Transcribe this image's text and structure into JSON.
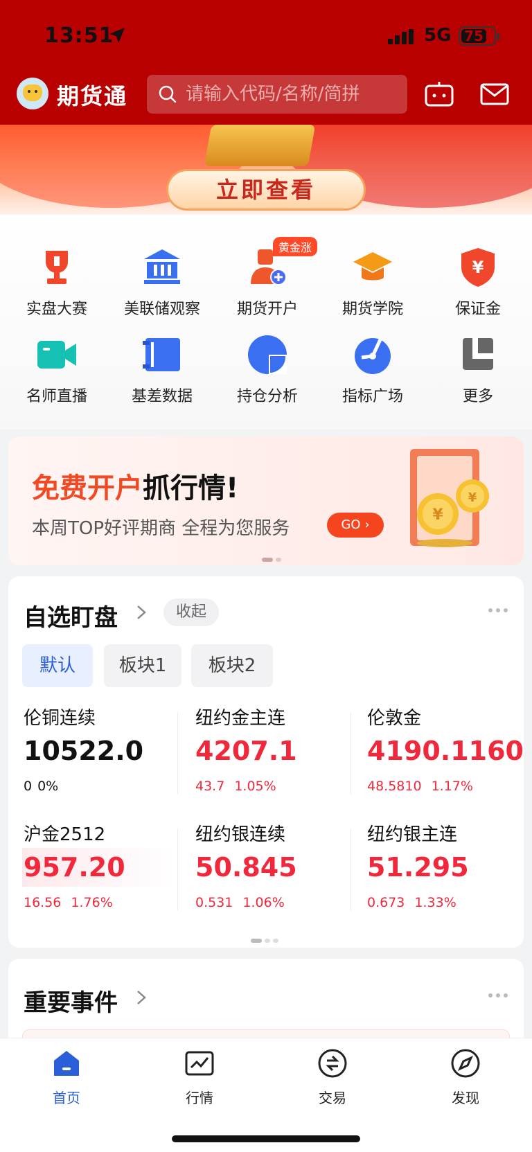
{
  "status": {
    "time": "13:51",
    "network": "5G",
    "battery": "75"
  },
  "header": {
    "app_name": "期货通",
    "search_placeholder": "请输入代码/名称/简拼"
  },
  "banner": {
    "button_label": "立即查看"
  },
  "quick_grid": [
    {
      "label": "实盘大赛",
      "icon": "trophy-icon"
    },
    {
      "label": "美联储观察",
      "icon": "bank-icon"
    },
    {
      "label": "期货开户",
      "icon": "user-add-icon",
      "badge": "黄金涨"
    },
    {
      "label": "期货学院",
      "icon": "graduation-cap-icon"
    },
    {
      "label": "保证金",
      "icon": "yuan-shield-icon"
    },
    {
      "label": "名师直播",
      "icon": "video-camera-icon"
    },
    {
      "label": "基差数据",
      "icon": "data-book-icon"
    },
    {
      "label": "持仓分析",
      "icon": "pie-chart-icon"
    },
    {
      "label": "指标广场",
      "icon": "gauge-icon"
    },
    {
      "label": "更多",
      "icon": "more-squares-icon"
    }
  ],
  "promo": {
    "title_highlight": "免费开户",
    "title_rest": "抓行情!",
    "subtitle": "本周TOP好评期商 全程为您服务",
    "go_label": "GO"
  },
  "watchlist": {
    "title": "自选盯盘",
    "collapse_label": "收起",
    "tabs": [
      "默认",
      "板块1",
      "板块2"
    ],
    "quotes": [
      {
        "name": "伦铜连续",
        "price": "10522.0",
        "change": "0",
        "pct": "0%",
        "trend": "flat"
      },
      {
        "name": "纽约金主连",
        "price": "4207.1",
        "change": "43.7",
        "pct": "1.05%",
        "trend": "up"
      },
      {
        "name": "伦敦金",
        "price": "4190.1160",
        "change": "48.5810",
        "pct": "1.17%",
        "trend": "up"
      },
      {
        "name": "沪金2512",
        "price": "957.20",
        "change": "16.56",
        "pct": "1.76%",
        "trend": "up"
      },
      {
        "name": "纽约银连续",
        "price": "50.845",
        "change": "0.531",
        "pct": "1.06%",
        "trend": "up"
      },
      {
        "name": "纽约银主连",
        "price": "51.295",
        "change": "0.673",
        "pct": "1.33%",
        "trend": "up"
      }
    ]
  },
  "events": {
    "title": "重要事件"
  },
  "tabbar": [
    {
      "label": "首页",
      "icon": "home-icon",
      "active": true
    },
    {
      "label": "行情",
      "icon": "market-chart-icon",
      "active": false
    },
    {
      "label": "交易",
      "icon": "trade-icon",
      "active": false
    },
    {
      "label": "发现",
      "icon": "compass-icon",
      "active": false
    }
  ],
  "colors": {
    "brand_red": "#b80000",
    "up_red": "#f0283c",
    "accent_blue": "#2b5fd9"
  }
}
